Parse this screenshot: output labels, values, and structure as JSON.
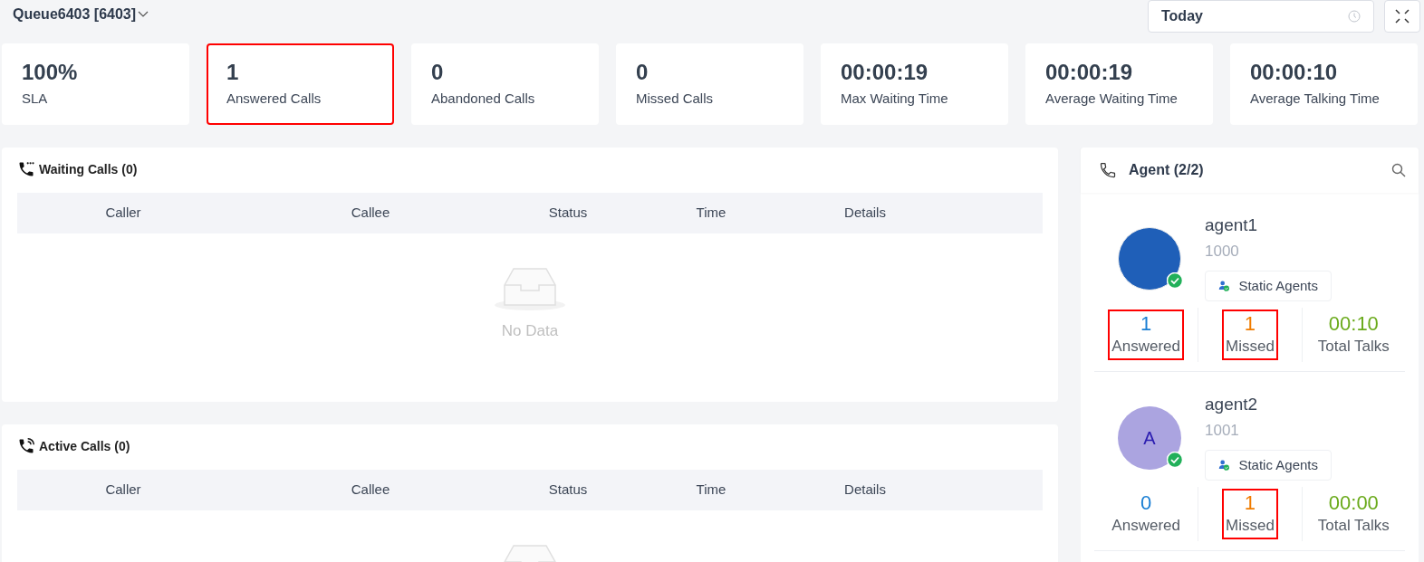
{
  "header": {
    "queue": "Queue6403 [6403]",
    "date_field": {
      "value": "Today"
    }
  },
  "stats": [
    {
      "value": "100%",
      "label": "SLA",
      "highlighted": false
    },
    {
      "value": "1",
      "label": "Answered Calls",
      "highlighted": true
    },
    {
      "value": "0",
      "label": "Abandoned Calls",
      "highlighted": false
    },
    {
      "value": "0",
      "label": "Missed Calls",
      "highlighted": false
    },
    {
      "value": "00:00:19",
      "label": "Max Waiting Time",
      "highlighted": false
    },
    {
      "value": "00:00:19",
      "label": "Average Waiting Time",
      "highlighted": false
    },
    {
      "value": "00:00:10",
      "label": "Average Talking Time",
      "highlighted": false
    }
  ],
  "panels": [
    {
      "kind": "waiting",
      "title": "Waiting Calls (0)",
      "columns": [
        "Caller",
        "Callee",
        "Status",
        "Time",
        "Details"
      ],
      "empty_text": "No Data"
    },
    {
      "kind": "active",
      "title": "Active Calls (0)",
      "columns": [
        "Caller",
        "Callee",
        "Status",
        "Time",
        "Details"
      ]
    }
  ],
  "agents_panel": {
    "title": "Agent (2/2)",
    "agents": [
      {
        "name": "agent1",
        "extension": "1000",
        "kind": "photo",
        "online": true,
        "tag": "Static Agents",
        "stats": [
          {
            "kind": "answered",
            "value": "1",
            "label": "Answered",
            "highlighted": true
          },
          {
            "kind": "missed",
            "value": "1",
            "label": "Missed",
            "highlighted": true
          },
          {
            "kind": "talk",
            "value": "00:10",
            "label": "Total Talks",
            "highlighted": false
          }
        ]
      },
      {
        "name": "agent2",
        "extension": "1001",
        "kind": "letter",
        "initial": "A",
        "online": true,
        "tag": "Static Agents",
        "stats": [
          {
            "kind": "answered",
            "value": "0",
            "label": "Answered",
            "highlighted": false
          },
          {
            "kind": "missed",
            "value": "1",
            "label": "Missed",
            "highlighted": true
          },
          {
            "kind": "talk",
            "value": "00:00",
            "label": "Total Talks",
            "highlighted": false
          }
        ]
      }
    ]
  }
}
